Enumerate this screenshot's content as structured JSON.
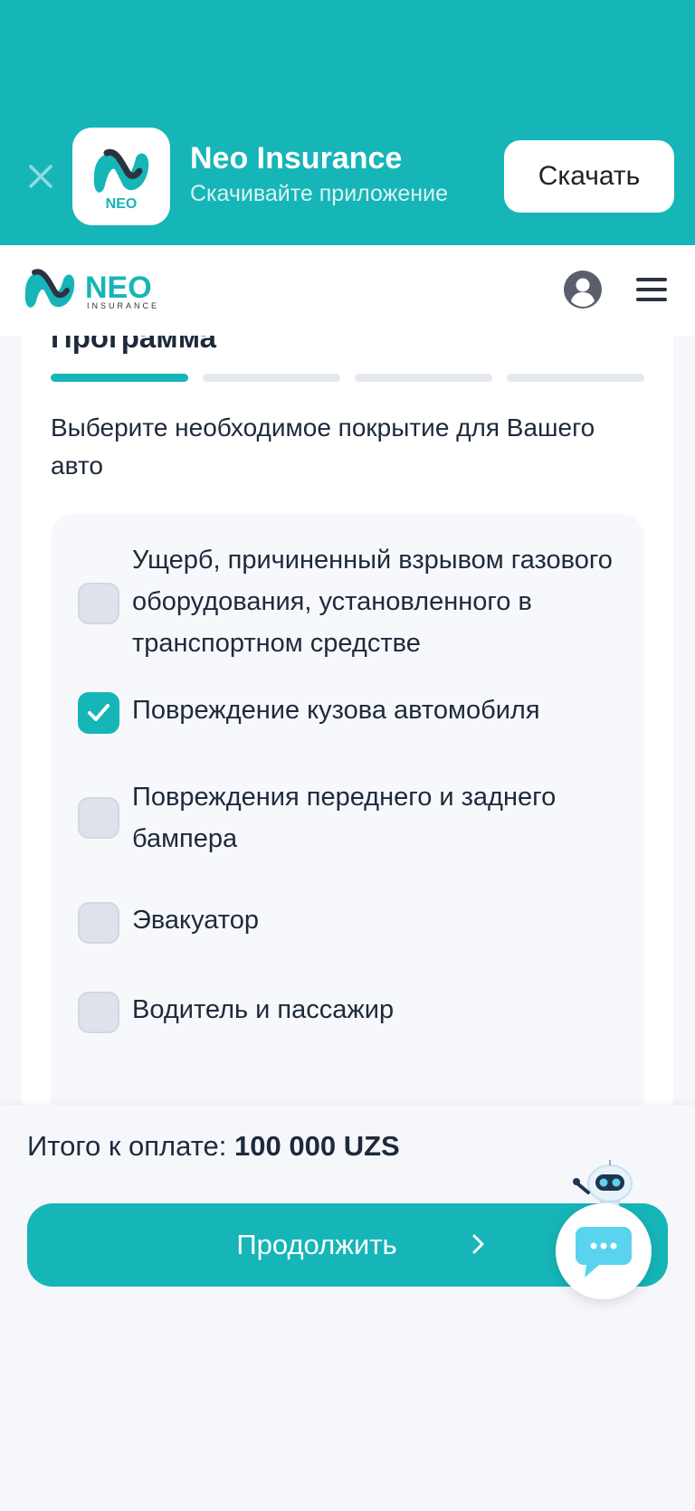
{
  "banner": {
    "close_icon": "close-icon",
    "app_name": "Neo Insurance",
    "subtitle": "Скачивайте приложение",
    "download_label": "Скачать",
    "color": "#16b5b8"
  },
  "header": {
    "logo_text": "NEO",
    "logo_subtext": "INSURANCE",
    "icons": [
      "profile-icon",
      "hamburger-menu-icon"
    ]
  },
  "card": {
    "title": "Программа",
    "steps_total": 4,
    "current_step": 1,
    "description": "Выберите необходимое покрытие для Вашего авто",
    "options": [
      {
        "label": "Ущерб, причиненный взрывом газового оборудования, установленного в транспортном средстве",
        "checked": false
      },
      {
        "label": "Повреждение кузова автомобиля",
        "checked": true
      },
      {
        "label": "Повреждения переднего и заднего бампера",
        "checked": false
      },
      {
        "label": "Эвакуатор",
        "checked": false
      },
      {
        "label": "Водитель и пассажир",
        "checked": false
      }
    ]
  },
  "footer": {
    "total_label": "Итого к оплате:",
    "total_value": "100 000 UZS",
    "continue_label": "Продолжить"
  },
  "chat": {
    "icon": "chat-bot-icon"
  },
  "colors": {
    "accent": "#16b5b8",
    "text": "#1e2a3b",
    "unchecked": "#dde2eb"
  }
}
